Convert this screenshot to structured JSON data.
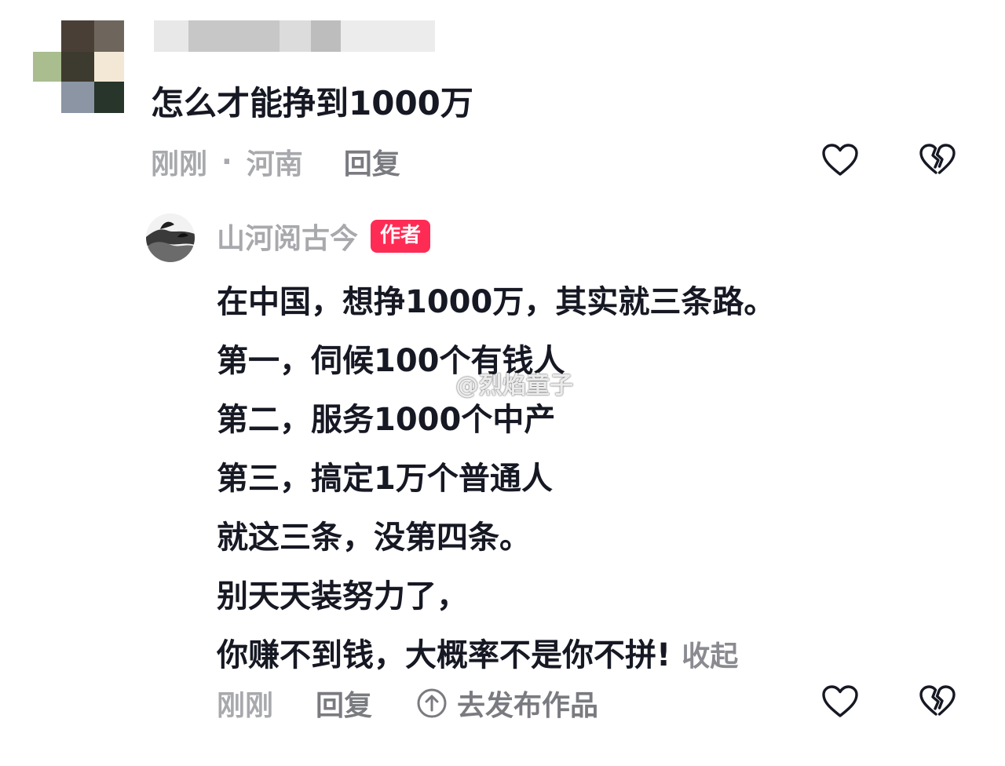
{
  "comment": {
    "text": "怎么才能挣到1000万",
    "time": "刚刚",
    "separator": "·",
    "location": "河南",
    "reply_label": "回复"
  },
  "reply": {
    "author": "山河阅古今",
    "author_badge": "作者",
    "lines": [
      "在中国，想挣1000万，其实就三条路。",
      "第一，伺候100个有钱人",
      "第二，服务1000个中产",
      "第三，搞定1万个普通人",
      "就这三条，没第四条。",
      "别天天装努力了，",
      "你赚不到钱，大概率不是你不拼!"
    ],
    "collapse_label": "收起",
    "time": "刚刚",
    "reply_label": "回复",
    "publish_label": "去发布作品"
  },
  "watermark": {
    "text": "@烈焰童子",
    "icon": "weibo-logo-icon"
  },
  "icons": {
    "like": "heart-outline-icon",
    "dislike": "broken-heart-icon",
    "publish": "up-arrow-circle-icon"
  },
  "colors": {
    "author_badge_bg": "#fe2c55",
    "meta_gray": "#a8a9ad",
    "text_dark": "#161823"
  }
}
